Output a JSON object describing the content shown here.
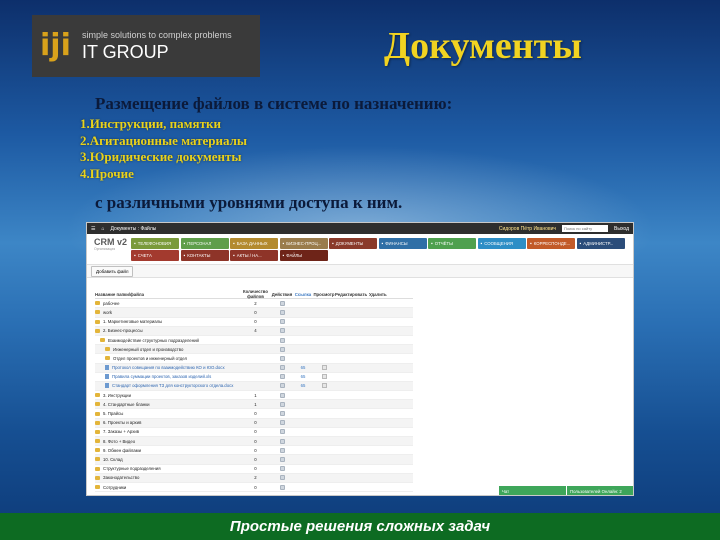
{
  "logo": {
    "mark": "iji",
    "tagline": "simple solutions to complex problems",
    "name": "IT GROUP"
  },
  "slide": {
    "title": "Документы",
    "intro": "Размещение файлов в системе по назначению:",
    "list": [
      "1.Инструкции, памятки",
      "2.Агитационные материалы",
      "3.Юридические документы",
      "4.Прочие"
    ],
    "outro": "с различными уровнями доступа к ним.",
    "footer": "Простые решения сложных задач"
  },
  "crm": {
    "window_title": "Документы : Файлы",
    "user_name": "Сидоров Пётр Иванович",
    "search_placeholder": "Поиск по сайту",
    "logout": "Выход",
    "brand": "CRM v2",
    "brand_sub": "Организация",
    "nav_row1": [
      {
        "label": "ТЕЛЕФОНОВИЯ",
        "color": "#7a9a3a"
      },
      {
        "label": "ПЕРСОНАЛ",
        "color": "#5f9e4a"
      },
      {
        "label": "БАЗА ДАННЫХ",
        "color": "#b38a2e"
      },
      {
        "label": "БИЗНЕС-ПРОЦ...",
        "color": "#9a7c4c"
      },
      {
        "label": "ДОКУМЕНТЫ",
        "color": "#8a3a2a"
      },
      {
        "label": "ФИНАНСЫ",
        "color": "#2f6fa6"
      },
      {
        "label": "ОТЧЁТЫ",
        "color": "#4ea04e"
      },
      {
        "label": "СООБЩЕНИЯ",
        "color": "#2d8ec6"
      },
      {
        "label": "КОРРЕСПОНДЕ...",
        "color": "#c25a28"
      },
      {
        "label": "АДМИНИСТР...",
        "color": "#2b4d7a"
      }
    ],
    "nav_row2": [
      {
        "label": "СЧЕТА",
        "color": "#a33a2e"
      },
      {
        "label": "КОНТАКТЫ",
        "color": "#8e3428"
      },
      {
        "label": "АКТЫ / НА...",
        "color": "#8e3428"
      },
      {
        "label": "ФАЙЛЫ",
        "color": "#6e2418"
      }
    ],
    "add_file": "Добавить файл",
    "columns": [
      "Название папки/файла",
      "Количество файлов",
      "Действия",
      "Ссылка",
      "Просмотр",
      "Редактировать",
      "Удалить"
    ],
    "rows": [
      {
        "kind": "folder",
        "name": "рабочее",
        "count": "2",
        "indent": 0
      },
      {
        "kind": "folder",
        "name": "work",
        "count": "0",
        "indent": 0
      },
      {
        "kind": "folder",
        "name": "1. Маркетинговые материалы",
        "count": "0",
        "indent": 0
      },
      {
        "kind": "folder",
        "name": "2. Бизнес-процессы",
        "count": "4",
        "indent": 0
      },
      {
        "kind": "folder",
        "name": "Взаимодействие структурных подразделений",
        "count": "",
        "indent": 1
      },
      {
        "kind": "folder",
        "name": "Инженерный отдел и производство",
        "count": "",
        "indent": 2
      },
      {
        "kind": "folder",
        "name": "Отдел проектов и инженерный отдел",
        "count": "",
        "indent": 2
      },
      {
        "kind": "file",
        "name": "Протокол совещания по взаимодействию КО и ЮО.docx",
        "count": "",
        "link": "65",
        "indent": 2
      },
      {
        "kind": "file",
        "name": "Правила суммации проектов, заказов изделий.xls",
        "count": "",
        "link": "65",
        "indent": 2
      },
      {
        "kind": "file",
        "name": "Стандарт оформления ТЗ для конструкторского отдела.docx",
        "count": "",
        "link": "65",
        "indent": 2
      },
      {
        "kind": "folder",
        "name": "3. Инструкции",
        "count": "1",
        "indent": 0
      },
      {
        "kind": "folder",
        "name": "4. Стандартные бланки",
        "count": "1",
        "indent": 0
      },
      {
        "kind": "folder",
        "name": "5. Прайсы",
        "count": "0",
        "indent": 0
      },
      {
        "kind": "folder",
        "name": "6. Проекты и архив",
        "count": "0",
        "indent": 0
      },
      {
        "kind": "folder",
        "name": "7. Заказы + Архив",
        "count": "0",
        "indent": 0
      },
      {
        "kind": "folder",
        "name": "8. Фото + Видео",
        "count": "0",
        "indent": 0
      },
      {
        "kind": "folder",
        "name": "9. Обмен файлами",
        "count": "0",
        "indent": 0
      },
      {
        "kind": "folder",
        "name": "10. Склад",
        "count": "0",
        "indent": 0
      },
      {
        "kind": "folder",
        "name": "Структурные подразделения",
        "count": "0",
        "indent": 0
      },
      {
        "kind": "folder",
        "name": "Законодательство",
        "count": "2",
        "indent": 0
      },
      {
        "kind": "folder",
        "name": "Сотрудники",
        "count": "0",
        "indent": 0
      }
    ],
    "chat": [
      "Чат",
      "Пользователей Онлайн: 2"
    ]
  }
}
